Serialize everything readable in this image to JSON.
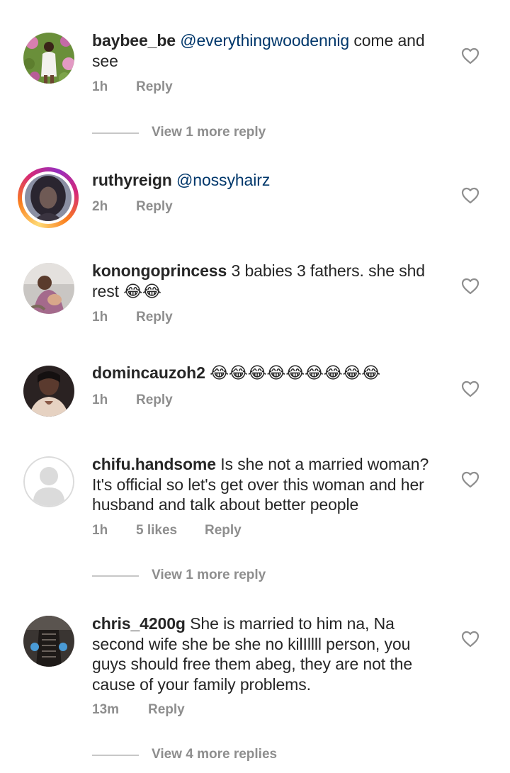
{
  "comments": [
    {
      "username": "baybee_be",
      "parts": [
        {
          "mention": "@everythingwoodennig"
        },
        {
          "text": " come and see"
        }
      ],
      "time": "1h",
      "likes": "",
      "reply_label": "Reply",
      "view_more": "View 1 more reply"
    },
    {
      "username": "ruthyreign",
      "parts": [
        {
          "mention": "@nossyhairz"
        }
      ],
      "time": "2h",
      "likes": "",
      "reply_label": "Reply",
      "view_more": ""
    },
    {
      "username": "konongoprincess",
      "parts": [
        {
          "text": "3 babies 3 fathers. she shd rest 😂😂"
        }
      ],
      "time": "1h",
      "likes": "",
      "reply_label": "Reply",
      "view_more": ""
    },
    {
      "username": "domincauzoh2",
      "parts": [
        {
          "text": "😂😂😂😂😂😂😂😂😂"
        }
      ],
      "time": "1h",
      "likes": "",
      "reply_label": "Reply",
      "view_more": ""
    },
    {
      "username": "chifu.handsome",
      "parts": [
        {
          "text": "Is she not a married woman? It's official so let's get over this woman and her husband and talk about better people"
        }
      ],
      "time": "1h",
      "likes": "5 likes",
      "reply_label": "Reply",
      "view_more": "View 1 more reply"
    },
    {
      "username": "chris_4200g",
      "parts": [
        {
          "text": "She is married to him na, Na second wife she be she no kilIllll person, you guys should free them abeg, they are not the cause of your family problems."
        }
      ],
      "time": "13m",
      "likes": "",
      "reply_label": "Reply",
      "view_more": "View 4 more replies"
    }
  ],
  "icons": {
    "like": "heart-outline-icon",
    "avatar_placeholder": "default-user-icon"
  },
  "colors": {
    "text": "#262626",
    "secondary": "#8e8e8e",
    "mention": "#00376b",
    "divider": "#c7c7c7"
  }
}
